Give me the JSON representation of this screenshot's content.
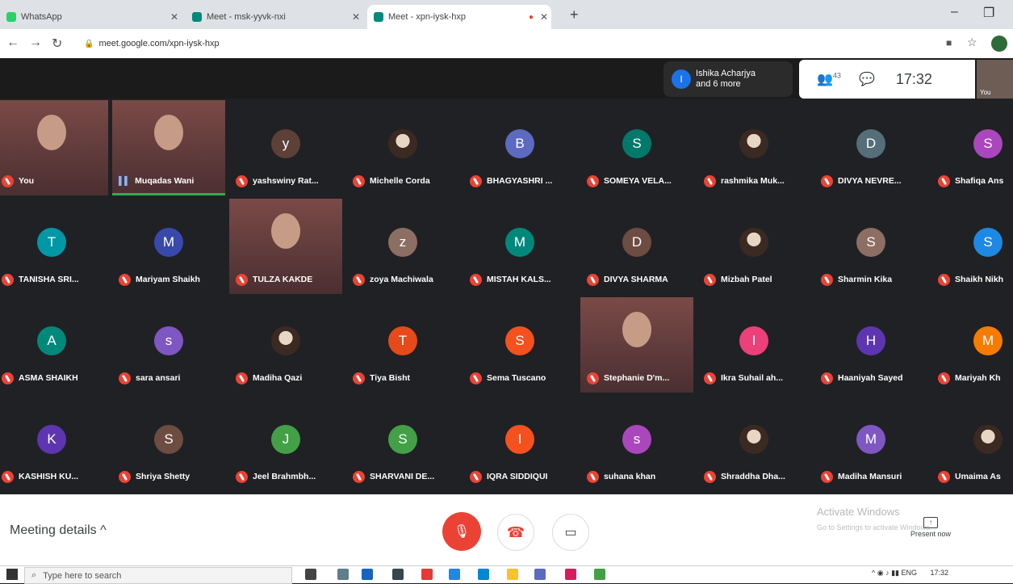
{
  "browser": {
    "tabs": [
      {
        "title": "WhatsApp",
        "active": false,
        "color": "#25d366"
      },
      {
        "title": "Meet - msk-yyvk-nxi",
        "active": false,
        "color": "#00897b"
      },
      {
        "title": "Meet - xpn-iysk-hxp",
        "active": true,
        "color": "#00897b"
      }
    ],
    "url": "meet.google.com/xpn-iysk-hxp"
  },
  "meet": {
    "notice": {
      "initial": "I",
      "line1": "Ishika Acharjya",
      "line2": "and 6 more"
    },
    "participant_count": "43",
    "clock": "17:32",
    "self_label": "You"
  },
  "participants": [
    {
      "name": "You",
      "kind": "video"
    },
    {
      "name": "Muqadas Wani",
      "kind": "video",
      "speaking": true
    },
    {
      "name": "yashswiny Rat...",
      "kind": "avatar",
      "initial": "y",
      "color": "#5d4037"
    },
    {
      "name": "Michelle Corda",
      "kind": "photo"
    },
    {
      "name": "BHAGYASHRI ...",
      "kind": "avatar",
      "initial": "B",
      "color": "#5c6bc0"
    },
    {
      "name": "SOMEYA VELA...",
      "kind": "avatar",
      "initial": "S",
      "color": "#00796b"
    },
    {
      "name": "rashmika Muk...",
      "kind": "photo"
    },
    {
      "name": "DIVYA NEVRE...",
      "kind": "avatar",
      "initial": "D",
      "color": "#546e7a"
    },
    {
      "name": "Shafiqa Ans",
      "kind": "avatar",
      "initial": "S",
      "color": "#ab47bc"
    },
    {
      "name": "TANISHA SRI...",
      "kind": "avatar",
      "initial": "T",
      "color": "#0097a7"
    },
    {
      "name": "Mariyam Shaikh",
      "kind": "avatar",
      "initial": "M",
      "color": "#3949ab"
    },
    {
      "name": "TULZA KAKDE",
      "kind": "video"
    },
    {
      "name": "zoya Machiwala",
      "kind": "avatar",
      "initial": "z",
      "color": "#8d6e63"
    },
    {
      "name": "MISTAH KALS...",
      "kind": "avatar",
      "initial": "M",
      "color": "#00897b"
    },
    {
      "name": "DIVYA SHARMA",
      "kind": "avatar",
      "initial": "D",
      "color": "#6d4c41"
    },
    {
      "name": "Mizbah Patel",
      "kind": "photo"
    },
    {
      "name": "Sharmin Kika",
      "kind": "avatar",
      "initial": "S",
      "color": "#8d6e63"
    },
    {
      "name": "Shaikh Nikh",
      "kind": "avatar",
      "initial": "S",
      "color": "#1e88e5"
    },
    {
      "name": "ASMA SHAIKH",
      "kind": "avatar",
      "initial": "A",
      "color": "#00897b"
    },
    {
      "name": "sara ansari",
      "kind": "avatar",
      "initial": "s",
      "color": "#7e57c2"
    },
    {
      "name": "Madiha Qazi",
      "kind": "photo"
    },
    {
      "name": "Tiya Bisht",
      "kind": "avatar",
      "initial": "T",
      "color": "#e64a19"
    },
    {
      "name": "Sema Tuscano",
      "kind": "avatar",
      "initial": "S",
      "color": "#f4511e"
    },
    {
      "name": "Stephanie D'm...",
      "kind": "video"
    },
    {
      "name": "Ikra Suhail ah...",
      "kind": "avatar",
      "initial": "I",
      "color": "#ec407a"
    },
    {
      "name": "Haaniyah Sayed",
      "kind": "avatar",
      "initial": "H",
      "color": "#5e35b1"
    },
    {
      "name": "Mariyah Kh",
      "kind": "avatar",
      "initial": "M",
      "color": "#f57c00"
    },
    {
      "name": "KASHISH KU...",
      "kind": "avatar",
      "initial": "K",
      "color": "#5e35b1"
    },
    {
      "name": "Shriya Shetty",
      "kind": "avatar",
      "initial": "S",
      "color": "#6d4c41"
    },
    {
      "name": "Jeel Brahmbh...",
      "kind": "avatar",
      "initial": "J",
      "color": "#43a047"
    },
    {
      "name": "SHARVANI DE...",
      "kind": "avatar",
      "initial": "S",
      "color": "#43a047"
    },
    {
      "name": "IQRA SIDDIQUI",
      "kind": "avatar",
      "initial": "I",
      "color": "#f4511e"
    },
    {
      "name": "suhana khan",
      "kind": "avatar",
      "initial": "s",
      "color": "#ab47bc"
    },
    {
      "name": "Shraddha Dha...",
      "kind": "photo"
    },
    {
      "name": "Madiha Mansuri",
      "kind": "avatar",
      "initial": "M",
      "color": "#7e57c2"
    },
    {
      "name": "Umaima As",
      "kind": "photo"
    }
  ],
  "controls": {
    "meeting_details": "Meeting details",
    "present_now": "Present now",
    "activate_title": "Activate Windows",
    "activate_sub": "Go to Settings to activate Windows."
  },
  "taskbar": {
    "search_placeholder": "Type here to search",
    "lang": "ENG",
    "time": "17:32"
  }
}
